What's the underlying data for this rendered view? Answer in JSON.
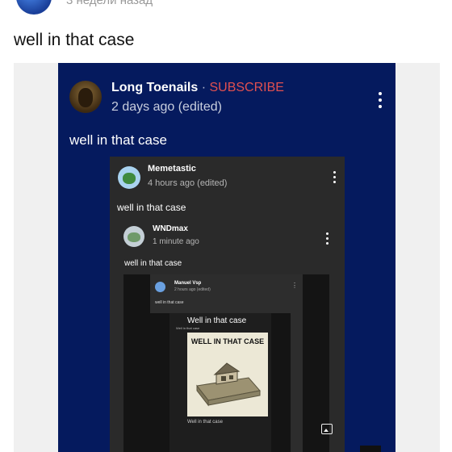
{
  "top": {
    "time": "3 недели назад"
  },
  "comment": {
    "text": "well in that case"
  },
  "card": {
    "author": "Long Toenails",
    "separator": " · ",
    "subscribe": "SUBSCRIBE",
    "time": "2 days ago (edited)",
    "body": "well in that case"
  },
  "inner": {
    "author": "Memetastic",
    "time": "4 hours ago (edited)",
    "body": "well in that case"
  },
  "level3": {
    "author": "WNDmax",
    "time": "1 minute ago",
    "body": "well in that case"
  },
  "level4": {
    "author": "Manuel Vsp",
    "time": "2 hours ago (edited)",
    "body": "well in that case"
  },
  "level5": {
    "caption": "Well in that case",
    "tiny": "Well in that case",
    "meme_title": "WELL IN THAT CASE",
    "bottom": "Well in that case"
  },
  "colors": {
    "card_bg": "#051a5e",
    "subscribe": "#e25050",
    "inner_bg": "#2a2a2a"
  }
}
